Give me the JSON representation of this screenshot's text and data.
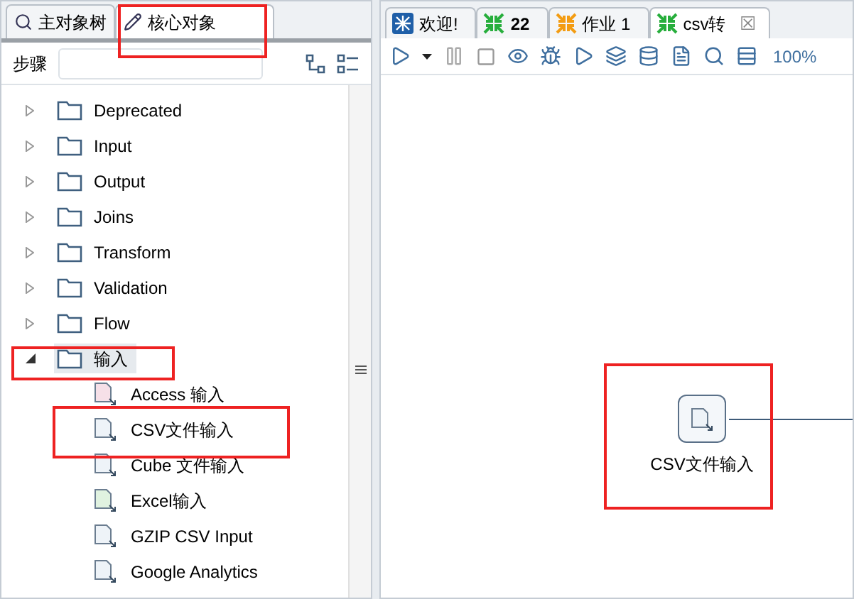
{
  "left_tabs": [
    {
      "label": "主对象树",
      "selected": false
    },
    {
      "label": "核心对象",
      "selected": true
    }
  ],
  "search": {
    "label": "步骤"
  },
  "tree": [
    {
      "label": "Deprecated",
      "expanded": false
    },
    {
      "label": "Input",
      "expanded": false
    },
    {
      "label": "Output",
      "expanded": false
    },
    {
      "label": "Joins",
      "expanded": false
    },
    {
      "label": "Transform",
      "expanded": false
    },
    {
      "label": "Validation",
      "expanded": false
    },
    {
      "label": "Flow",
      "expanded": false
    },
    {
      "label": "输入",
      "expanded": true,
      "selected": true,
      "children": [
        {
          "label": "Access 输入",
          "kind": "access"
        },
        {
          "label": "CSV文件输入",
          "kind": "text"
        },
        {
          "label": "Cube 文件输入",
          "kind": "cube"
        },
        {
          "label": "Excel输入",
          "kind": "excel"
        },
        {
          "label": "GZIP CSV Input",
          "kind": "text"
        },
        {
          "label": "Google Analytics",
          "kind": "google"
        }
      ]
    }
  ],
  "editor_tabs": [
    {
      "label": "欢迎!",
      "kind": "welcome",
      "selected": false,
      "bold": false
    },
    {
      "label": "22",
      "kind": "transform",
      "selected": false,
      "bold": true
    },
    {
      "label": "作业 1",
      "kind": "job",
      "selected": false,
      "bold": false
    },
    {
      "label": "csv转",
      "kind": "transform",
      "selected": true,
      "bold": false,
      "close": "☒"
    }
  ],
  "zoom": "100%",
  "canvas": {
    "node": {
      "label": "CSV文件输入"
    }
  }
}
